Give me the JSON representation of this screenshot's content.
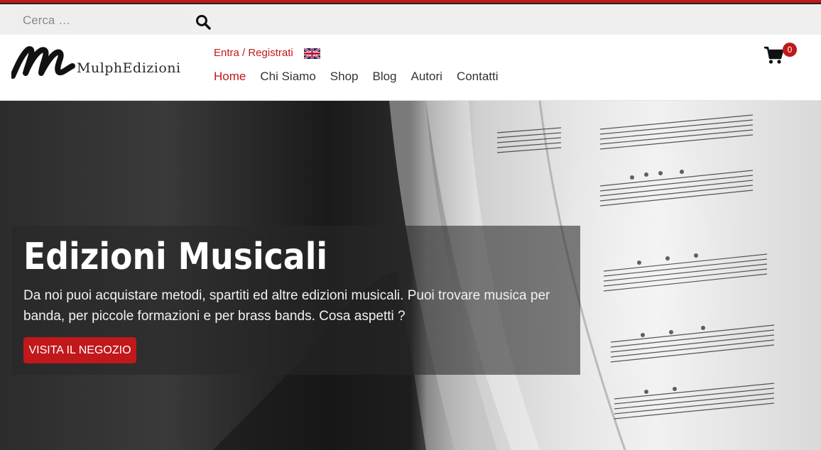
{
  "search": {
    "placeholder": "Cerca …"
  },
  "logo": {
    "text_part1": "Mulph",
    "text_part2": "Edizioni"
  },
  "header": {
    "login_label": "Entra / Registrati",
    "language_flag": "uk-flag-icon"
  },
  "nav": {
    "items": [
      {
        "label": "Home",
        "active": true
      },
      {
        "label": "Chi Siamo",
        "active": false
      },
      {
        "label": "Shop",
        "active": false
      },
      {
        "label": "Blog",
        "active": false
      },
      {
        "label": "Autori",
        "active": false
      },
      {
        "label": "Contatti",
        "active": false
      }
    ]
  },
  "cart": {
    "count": "0",
    "icon": "cart-icon"
  },
  "hero": {
    "title": "Edizioni Musicali",
    "text": "Da noi puoi acquistare metodi, spartiti ed altre edizioni musicali. Puoi trovare musica per banda, per piccole formazioni e per brass bands. Cosa aspetti ?",
    "button_label": "VISITA IL NEGOZIO"
  },
  "colors": {
    "accent": "#c0181b",
    "top_bar": "#efefef",
    "nav_text": "#333333"
  }
}
